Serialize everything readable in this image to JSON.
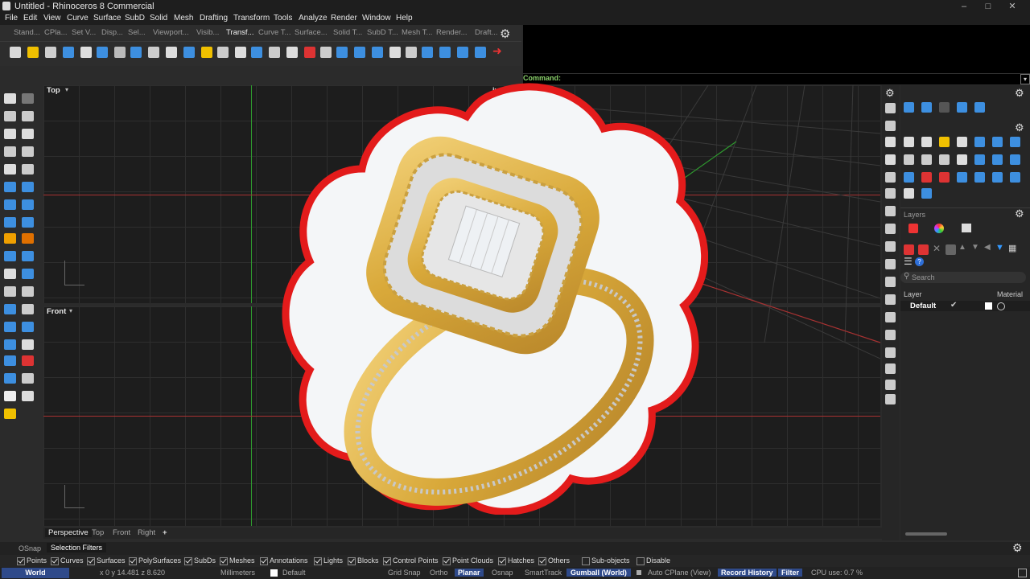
{
  "window": {
    "title": "Untitled - Rhinoceros 8 Commercial"
  },
  "menu": [
    "File",
    "Edit",
    "View",
    "Curve",
    "Surface",
    "SubD",
    "Solid",
    "Mesh",
    "Drafting",
    "Transform",
    "Tools",
    "Analyze",
    "Render",
    "Window",
    "Help"
  ],
  "toolbar_tabs": [
    "Stand...",
    "CPla...",
    "Set V...",
    "Disp...",
    "Sel...",
    "Viewport...",
    "Visib...",
    "Transf...",
    "Curve T...",
    "Surface...",
    "Solid T...",
    "SubD T...",
    "Mesh T...",
    "Render...",
    "Draft..."
  ],
  "active_toolbar_tab": "Transf...",
  "command": {
    "label": "Command:"
  },
  "viewports": {
    "top": "Top",
    "front": "Front",
    "perspective": "Perspective",
    "perspective_short": "ive"
  },
  "viewport_tabs": [
    "Perspective",
    "Top",
    "Front",
    "Right"
  ],
  "add_tab": "+",
  "right_panel": {
    "layers_title": "Layers",
    "search_placeholder": "Search",
    "col_layer": "Layer",
    "col_material": "Material",
    "row_default": "Default"
  },
  "osnap_tabs": {
    "osnap": "OSnap",
    "selection_filters": "Selection Filters"
  },
  "filters": [
    {
      "label": "Points",
      "checked": true
    },
    {
      "label": "Curves",
      "checked": true
    },
    {
      "label": "Surfaces",
      "checked": true
    },
    {
      "label": "PolySurfaces",
      "checked": true
    },
    {
      "label": "SubDs",
      "checked": true
    },
    {
      "label": "Meshes",
      "checked": true
    },
    {
      "label": "Annotations",
      "checked": true
    },
    {
      "label": "Lights",
      "checked": true
    },
    {
      "label": "Blocks",
      "checked": true
    },
    {
      "label": "Control Points",
      "checked": true
    },
    {
      "label": "Point Clouds",
      "checked": true
    },
    {
      "label": "Hatches",
      "checked": true
    },
    {
      "label": "Others",
      "checked": true
    },
    {
      "label": "Sub-objects",
      "checked": false
    },
    {
      "label": "Disable",
      "checked": false
    }
  ],
  "status": {
    "cplane": "World",
    "coords": "x 0   y 14.481   z 8.620",
    "units": "Millimeters",
    "layer": "Default",
    "grid_snap": "Grid Snap",
    "ortho": "Ortho",
    "planar": "Planar",
    "osnap": "Osnap",
    "smarttrack": "SmartTrack",
    "gumball": "Gumball (World)",
    "auto_cplane": "Auto CPlane (View)",
    "record_history": "Record History",
    "filter": "Filter",
    "cpu": "CPU use: 0.7 %"
  },
  "colors": {
    "accent": "#2f4a8a",
    "red_outline": "#e31b1b",
    "gold": "#d9b24a",
    "axis_green": "#2f9a2f",
    "axis_red": "#a83232"
  }
}
